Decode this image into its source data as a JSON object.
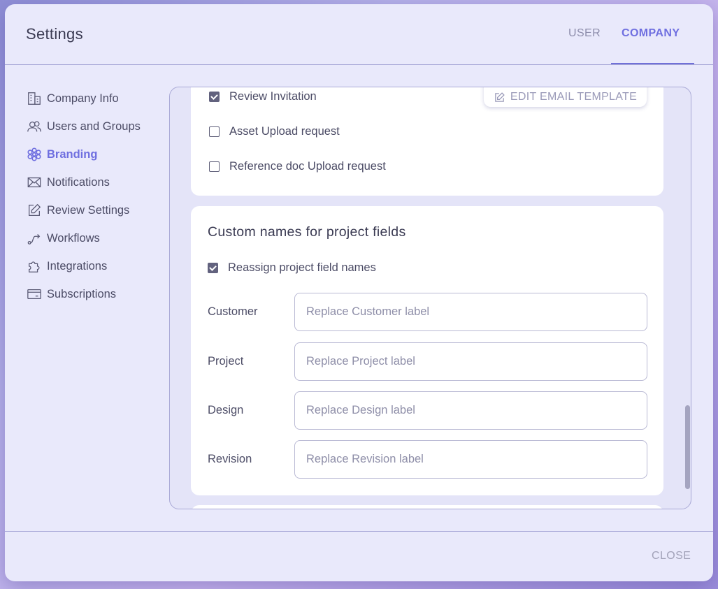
{
  "header": {
    "title": "Settings",
    "tabs": [
      {
        "label": "USER",
        "active": false
      },
      {
        "label": "COMPANY",
        "active": true
      }
    ]
  },
  "sidebar": {
    "items": [
      {
        "label": "Company Info",
        "icon": "building-icon",
        "active": false
      },
      {
        "label": "Users and Groups",
        "icon": "users-icon",
        "active": false
      },
      {
        "label": "Branding",
        "icon": "flower-icon",
        "active": true
      },
      {
        "label": "Notifications",
        "icon": "envelope-icon",
        "active": false
      },
      {
        "label": "Review Settings",
        "icon": "edit-icon",
        "active": false
      },
      {
        "label": "Workflows",
        "icon": "workflow-icon",
        "active": false
      },
      {
        "label": "Integrations",
        "icon": "puzzle-icon",
        "active": false
      },
      {
        "label": "Subscriptions",
        "icon": "card-icon",
        "active": false
      }
    ]
  },
  "notifications_card": {
    "edit_template_label": "EDIT EMAIL TEMPLATE",
    "checkboxes": [
      {
        "label": "Review Invitation",
        "checked": true
      },
      {
        "label": "Asset Upload request",
        "checked": false
      },
      {
        "label": "Reference doc Upload request",
        "checked": false
      }
    ]
  },
  "custom_names": {
    "title": "Custom names for project fields",
    "reassign_label": "Reassign project field names",
    "reassign_checked": true,
    "fields": [
      {
        "label": "Customer",
        "value": "",
        "placeholder": "Replace Customer label"
      },
      {
        "label": "Project",
        "value": "",
        "placeholder": "Replace Project label"
      },
      {
        "label": "Design",
        "value": "",
        "placeholder": "Replace Design label"
      },
      {
        "label": "Revision",
        "value": "",
        "placeholder": "Replace Revision label"
      }
    ]
  },
  "footer": {
    "close_label": "CLOSE"
  },
  "colors": {
    "accent": "#6f6fe0",
    "text": "#4c4c66",
    "muted": "#9a9ab8"
  }
}
